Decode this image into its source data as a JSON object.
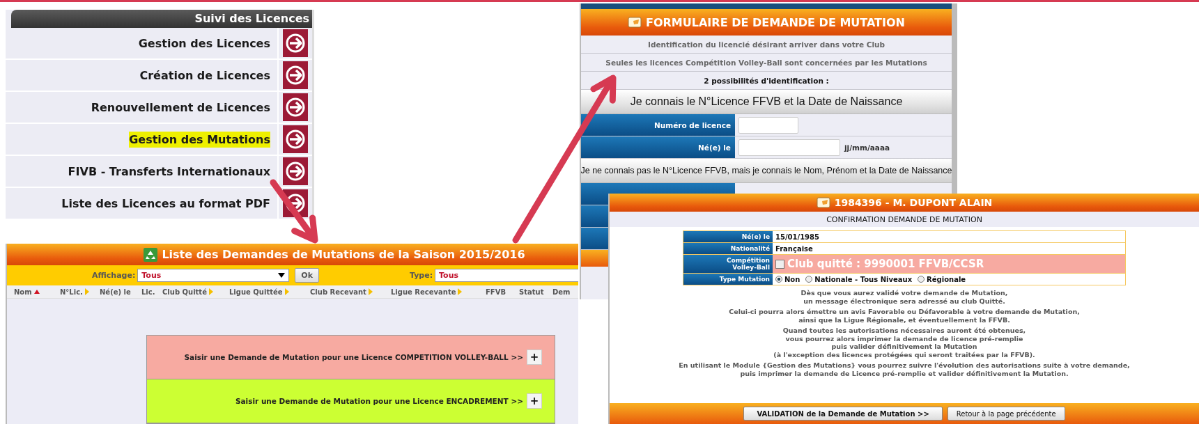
{
  "menu": {
    "title": "Suivi des Licences",
    "items": [
      {
        "label": "Gestion des Licences",
        "highlighted": false
      },
      {
        "label": "Création de Licences",
        "highlighted": false
      },
      {
        "label": "Renouvellement de Licences",
        "highlighted": false
      },
      {
        "label": "Gestion des Mutations",
        "highlighted": true
      },
      {
        "label": "FIVB - Transferts Internationaux",
        "highlighted": false
      },
      {
        "label": "Liste des Licences au format PDF",
        "highlighted": false
      }
    ]
  },
  "list_window": {
    "title": "Liste des Demandes de Mutations de la Saison 2015/2016",
    "filter": {
      "label": "Affichage:",
      "value": "Tous",
      "button": "Ok",
      "type_label": "Type:",
      "type_value": "Tous"
    },
    "columns": [
      {
        "label": "Nom",
        "sorted": true,
        "sortable": false
      },
      {
        "label": "N°Lic.",
        "sorted": false,
        "sortable": true
      },
      {
        "label": "Né(e) le",
        "sorted": false,
        "sortable": false
      },
      {
        "label": "Lic.",
        "sorted": false,
        "sortable": false
      },
      {
        "label": "Club Quitté",
        "sorted": false,
        "sortable": true
      },
      {
        "label": "Ligue Quittée",
        "sorted": false,
        "sortable": true
      },
      {
        "label": "Club Recevant",
        "sorted": false,
        "sortable": true
      },
      {
        "label": "Ligue Recevante",
        "sorted": false,
        "sortable": true
      },
      {
        "label": "FFVB",
        "sorted": false,
        "sortable": false
      },
      {
        "label": "Statut",
        "sorted": false,
        "sortable": false
      },
      {
        "label": "Dem",
        "sorted": false,
        "sortable": false
      }
    ],
    "actions": [
      {
        "label": "Saisir une Demande de Mutation pour une Licence COMPETITION VOLLEY-BALL >>",
        "button": "+",
        "color": "#f7aaa1"
      },
      {
        "label": "Saisir une Demande de Mutation pour une Licence ENCADREMENT >>",
        "button": "+",
        "color": "#ccff33"
      }
    ]
  },
  "form_window": {
    "title": "FORMULAIRE DE DEMANDE DE MUTATION",
    "notes": [
      {
        "text": "Identification du licencié désirant arriver dans votre Club",
        "kind": "muted"
      },
      {
        "text": "Seules les licences Compétition Volley-Ball sont concernées par les Mutations",
        "kind": "muted"
      },
      {
        "text": "2 possibilités d'identification :",
        "kind": "strong"
      }
    ],
    "section_1": "Je connais le N°Licence FFVB et la Date de Naissance",
    "fields": [
      {
        "label": "Numéro de licence",
        "kind": "number"
      },
      {
        "label": "Né(e) le",
        "kind": "date",
        "hint": "jj/mm/aaaa"
      }
    ],
    "section_2": "Je ne connais pas le N°Licence FFVB, mais je connais le Nom, Prénom et la Date de Naissance"
  },
  "confirm_window": {
    "title": "1984396 - M. DUPONT ALAIN",
    "subtitle": "CONFIRMATION DEMANDE DE MUTATION",
    "rows": [
      {
        "label": "Né(e) le",
        "kind": "text",
        "value": "15/01/1985"
      },
      {
        "label": "Nationalité",
        "kind": "text",
        "value": "Française"
      },
      {
        "label": "Compétition\nVolley-Ball",
        "kind": "checkbox",
        "checked": false,
        "value": "Club quitté : 9990001 FFVB/CCSR"
      },
      {
        "label": "Type Mutation",
        "kind": "radio",
        "options": [
          {
            "label": "Non",
            "selected": true
          },
          {
            "label": "Nationale - Tous Niveaux",
            "selected": false
          },
          {
            "label": "Régionale",
            "selected": false
          }
        ]
      }
    ],
    "paragraphs": [
      "Dès que vous aurez validé votre demande de Mutation,\nun message électronique sera adressé au club Quitté.",
      "Celui-ci pourra alors émettre un avis Favorable ou Défavorable à votre demande de Mutation,\nainsi que la Ligue Régionale, et éventuellement la FFVB.",
      "Quand toutes les autorisations nécessaires auront été obtenues,\nvous pourrez alors imprimer la demande de licence pré-remplie\npuis valider définitivement la Mutation\n(à l'exception des licences protégées qui seront traitées par la FFVB).",
      "En utilisant le Module {Gestion des Mutations} vous pourrez suivre l'évolution des autorisations suite à votre demande,\npuis imprimer la demande de Licence pré-remplie et valider définitivement la Mutation."
    ],
    "buttons": [
      "VALIDATION de la Demande de Mutation >>",
      "Retour à la page précédente"
    ]
  }
}
